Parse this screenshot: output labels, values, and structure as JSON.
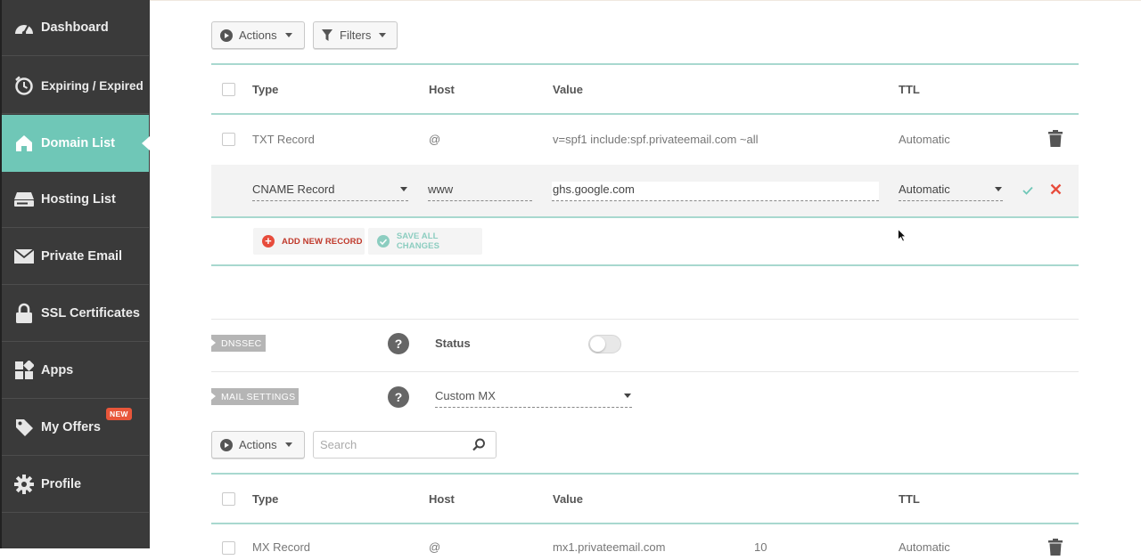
{
  "sidebar": {
    "items": [
      {
        "label": "Dashboard",
        "icon": "dashboard-gauge-icon"
      },
      {
        "label": "Expiring / Expired",
        "icon": "clock-icon"
      },
      {
        "label": "Domain List",
        "icon": "home-icon",
        "active": true
      },
      {
        "label": "Hosting List",
        "icon": "server-icon"
      },
      {
        "label": "Private Email",
        "icon": "envelope-icon"
      },
      {
        "label": "SSL Certificates",
        "icon": "lock-icon"
      },
      {
        "label": "Apps",
        "icon": "apps-grid-icon"
      },
      {
        "label": "My Offers",
        "icon": "tag-icon",
        "badge": "NEW"
      },
      {
        "label": "Profile",
        "icon": "gear-icon"
      }
    ]
  },
  "toolbar": {
    "actions_label": "Actions",
    "filters_label": "Filters"
  },
  "records_table": {
    "headers": {
      "type": "Type",
      "host": "Host",
      "value": "Value",
      "ttl": "TTL"
    },
    "rows": [
      {
        "type": "TXT Record",
        "host": "@",
        "value": "v=spf1 include:spf.privateemail.com ~all",
        "ttl": "Automatic"
      }
    ],
    "edit_row": {
      "type": "CNAME Record",
      "host": "www",
      "value": "ghs.google.com",
      "ttl": "Automatic"
    },
    "add_label": "ADD NEW RECORD",
    "save_label": "SAVE ALL CHANGES"
  },
  "dnssec": {
    "tag": "DNSSEC",
    "status_label": "Status",
    "enabled": false
  },
  "mail_settings": {
    "tag": "MAIL SETTINGS",
    "selected": "Custom MX"
  },
  "mail_toolbar": {
    "actions_label": "Actions",
    "search_placeholder": "Search"
  },
  "mail_table": {
    "headers": {
      "type": "Type",
      "host": "Host",
      "value": "Value",
      "ttl": "TTL"
    },
    "rows": [
      {
        "type": "MX Record",
        "host": "@",
        "value": "mx1.privateemail.com",
        "priority": "10",
        "ttl": "Automatic"
      }
    ]
  },
  "colors": {
    "sidebar_bg": "#3a3a3a",
    "accent": "#6fc7b7",
    "danger": "#e74c3c",
    "success": "#6fc7b7"
  }
}
